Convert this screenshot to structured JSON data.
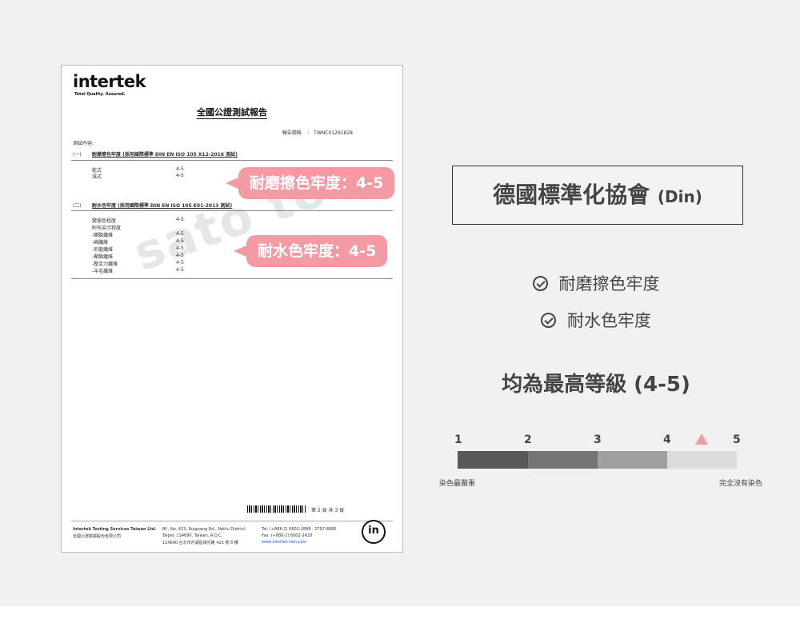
{
  "report": {
    "logo": "intertek",
    "tagline": "Total Quality. Assured.",
    "title": "全國公證測試報告",
    "report_no_label": "報告號碼",
    "report_no_sep": ":",
    "report_no": "TWNC01291828",
    "content_label": "測試內容:",
    "watermark": "sato to",
    "section1": {
      "num": "(一)",
      "title": "耐摩擦色牢度 (採用國際標準 DIN EN ISO 105 X12-2016 測試)",
      "rows": [
        {
          "label": "乾式",
          "value": "4-5"
        },
        {
          "label": "濕式",
          "value": "4-5"
        }
      ]
    },
    "section2": {
      "num": "(二)",
      "title": "耐水色牢度 (採用國際標準 DIN EN ISO 105 E01-2013 測試)",
      "rows": [
        {
          "label": "變褪色程度",
          "value": "4-5"
        },
        {
          "label": "附布染污程度",
          "value": ""
        },
        {
          "label": "-醋酸纖維",
          "value": "4-5"
        },
        {
          "label": "-棉纖維",
          "value": "4-5"
        },
        {
          "label": "-尼龍纖維",
          "value": "4-5"
        },
        {
          "label": "-聚酯纖維",
          "value": "4-5"
        },
        {
          "label": "-壓克力纖維",
          "value": "4-5"
        },
        {
          "label": "-羊毛纖維",
          "value": "4-5"
        }
      ]
    },
    "page_info": "第 2 頁 共 3 頁",
    "footer": {
      "company_en": "Intertek Testing Services Taiwan Ltd.",
      "company_zh": "全國公證檢驗股份有限公司",
      "addr1": "8F., No. 423, Ruiguang Rd., Neihu District,",
      "addr2": "Taipei, 114690, Taiwan, R.O.C.",
      "addr3": "114690 台北市內湖區瑞光路 423 號 8 樓",
      "tel": "Tel: (+886-2) 6602-2888 · 2797-8885",
      "fax": "Fax: (+886-2) 6602-2420",
      "web": "www.intertek-twn.com",
      "badge": "in"
    }
  },
  "callouts": {
    "rub": "耐磨擦色牢度：4-5",
    "water": "耐水色牢度：4-5"
  },
  "standard": {
    "title": "德國標準化協會",
    "suffix": "(Din)"
  },
  "checks": [
    "耐磨擦色牢度",
    "耐水色牢度"
  ],
  "headline": "均為最高等級 (4-5)",
  "scale": {
    "numbers": [
      "1",
      "2",
      "3",
      "4",
      "5"
    ],
    "colors": [
      "#58585a",
      "#737374",
      "#9f9fa0",
      "#dcdcdc"
    ],
    "marker_color": "#f49aa3",
    "marker_value": 4.5,
    "left_label": "染色最嚴重",
    "right_label": "完全沒有染色"
  }
}
